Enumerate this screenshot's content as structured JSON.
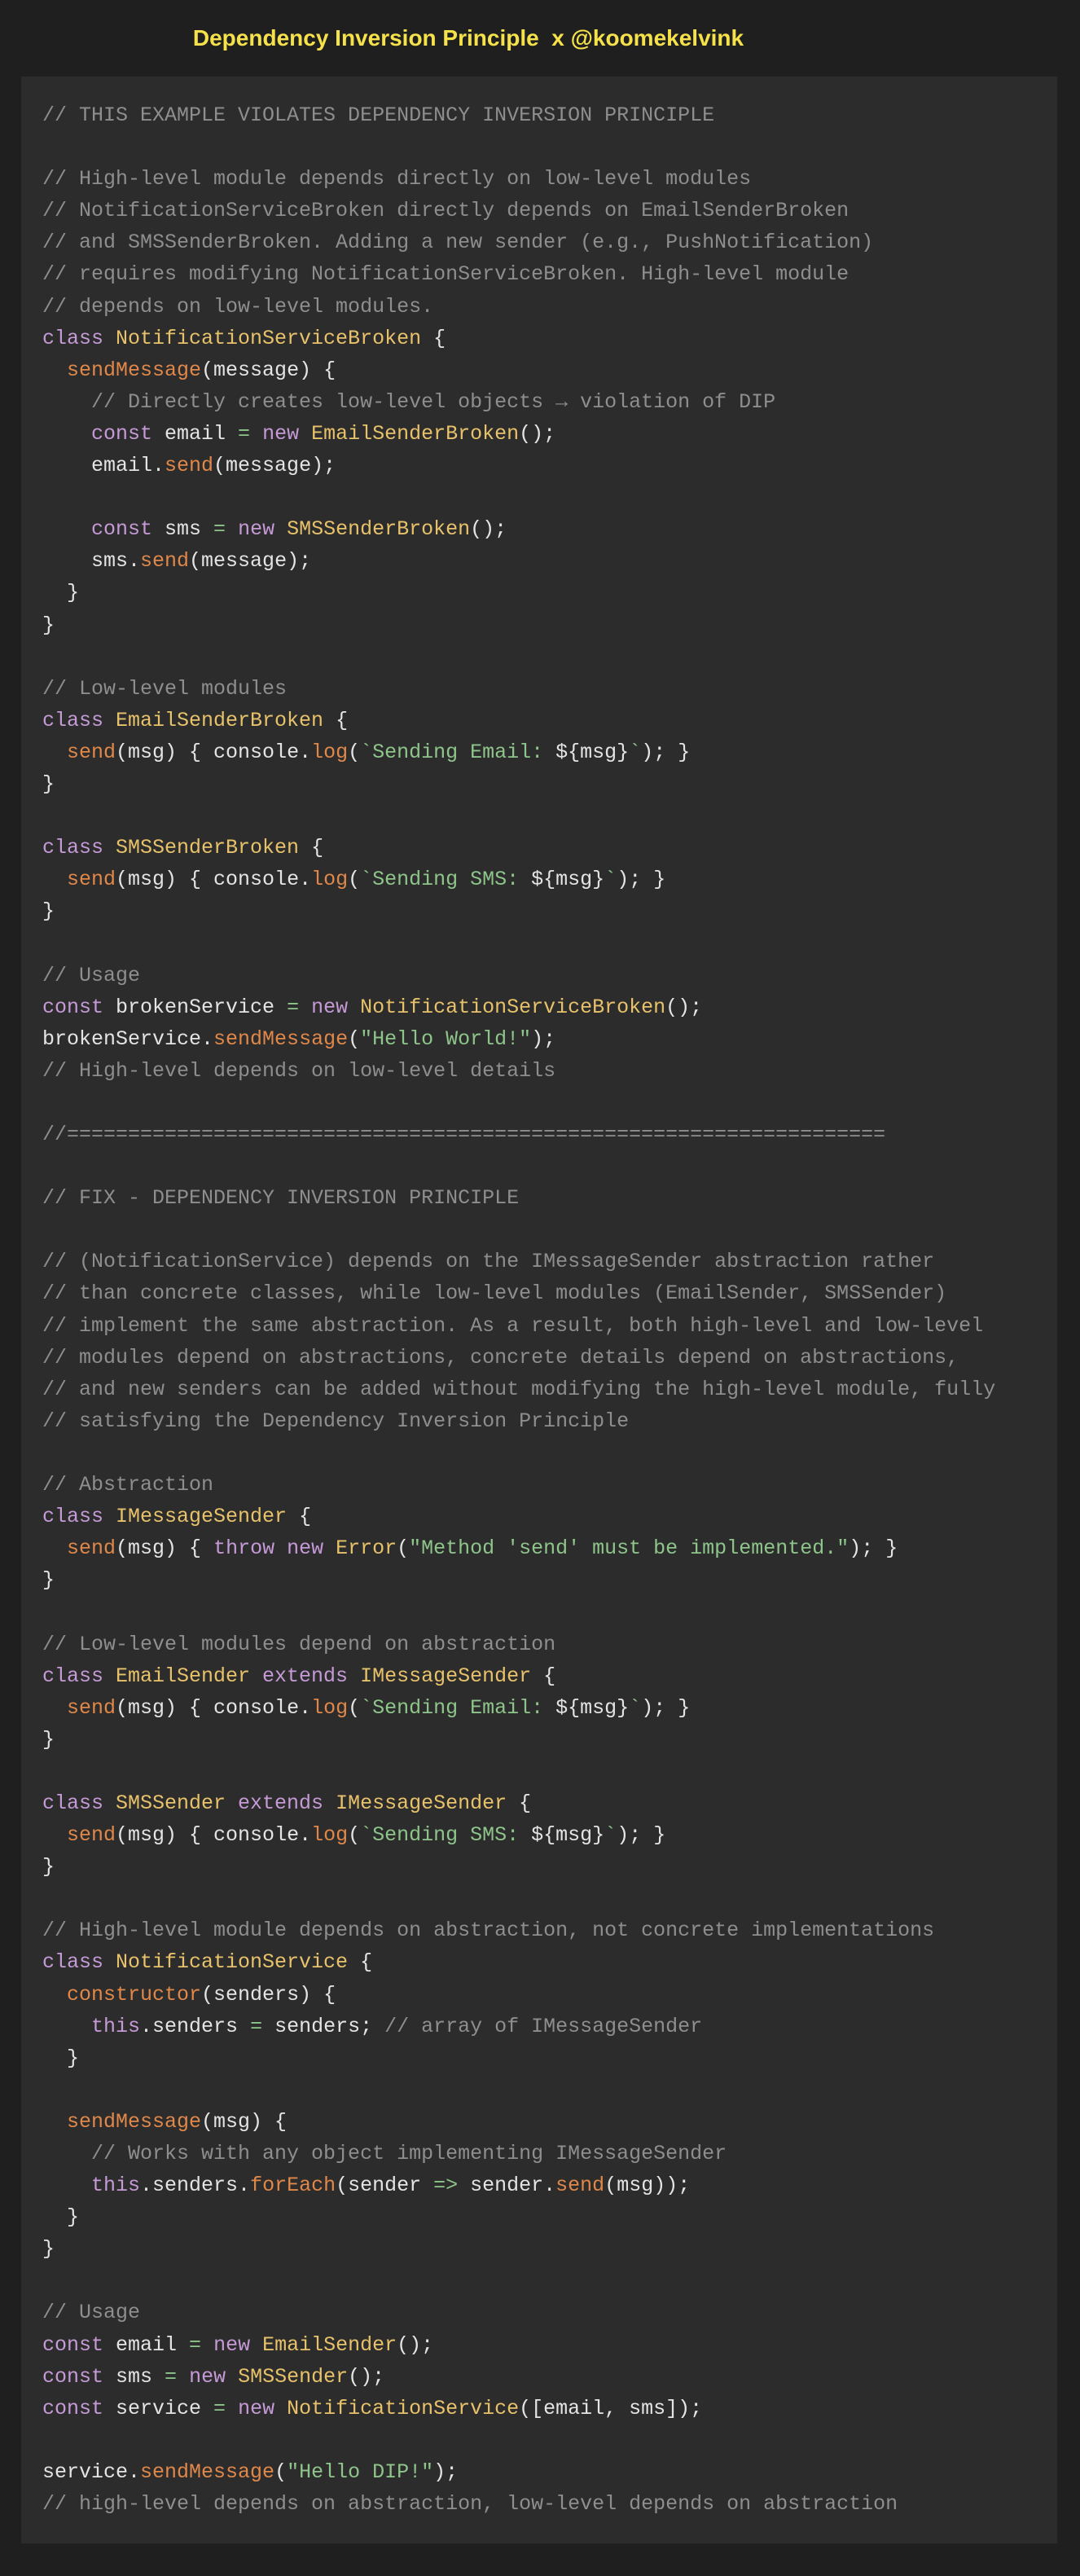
{
  "header": {
    "title": "Dependency Inversion Principle  x @koomekelvink"
  },
  "colors": {
    "background": "#1f1f1f",
    "panel": "#2c2c2c",
    "title": "#f5e14a",
    "comment": "#8e8e8e",
    "keyword": "#c59ad6",
    "class_name": "#e8c26a",
    "function": "#e0884a",
    "string": "#8ec58a",
    "plain": "#e4e4e4"
  },
  "code": {
    "language": "javascript",
    "lines": [
      [
        [
          "comment",
          "// THIS EXAMPLE VIOLATES DEPENDENCY INVERSION PRINCIPLE"
        ]
      ],
      [],
      [
        [
          "comment",
          "// High-level module depends directly on low-level modules"
        ]
      ],
      [
        [
          "comment",
          "// NotificationServiceBroken directly depends on EmailSenderBroken"
        ]
      ],
      [
        [
          "comment",
          "// and SMSSenderBroken. Adding a new sender (e.g., PushNotification)"
        ]
      ],
      [
        [
          "comment",
          "// requires modifying NotificationServiceBroken. High-level module"
        ]
      ],
      [
        [
          "comment",
          "// depends on low-level modules."
        ]
      ],
      [
        [
          "kw",
          "class "
        ],
        [
          "cls",
          "NotificationServiceBroken"
        ],
        [
          "plain",
          " {"
        ]
      ],
      [
        [
          "plain",
          "  "
        ],
        [
          "fn",
          "sendMessage"
        ],
        [
          "plain",
          "(message) {"
        ]
      ],
      [
        [
          "comment",
          "    // Directly creates low-level objects → violation of DIP"
        ]
      ],
      [
        [
          "plain",
          "    "
        ],
        [
          "kw",
          "const "
        ],
        [
          "plain",
          "email "
        ],
        [
          "op",
          "="
        ],
        [
          "plain",
          " "
        ],
        [
          "kw",
          "new "
        ],
        [
          "cls",
          "EmailSenderBroken"
        ],
        [
          "plain",
          "();"
        ]
      ],
      [
        [
          "plain",
          "    email."
        ],
        [
          "fn",
          "send"
        ],
        [
          "plain",
          "(message);"
        ]
      ],
      [],
      [
        [
          "plain",
          "    "
        ],
        [
          "kw",
          "const "
        ],
        [
          "plain",
          "sms "
        ],
        [
          "op",
          "="
        ],
        [
          "plain",
          " "
        ],
        [
          "kw",
          "new "
        ],
        [
          "cls",
          "SMSSenderBroken"
        ],
        [
          "plain",
          "();"
        ]
      ],
      [
        [
          "plain",
          "    sms."
        ],
        [
          "fn",
          "send"
        ],
        [
          "plain",
          "(message);"
        ]
      ],
      [
        [
          "plain",
          "  }"
        ]
      ],
      [
        [
          "plain",
          "}"
        ]
      ],
      [],
      [
        [
          "comment",
          "// Low-level modules"
        ]
      ],
      [
        [
          "kw",
          "class "
        ],
        [
          "cls",
          "EmailSenderBroken"
        ],
        [
          "plain",
          " {"
        ]
      ],
      [
        [
          "plain",
          "  "
        ],
        [
          "fn",
          "send"
        ],
        [
          "plain",
          "(msg) { console."
        ],
        [
          "fn",
          "log"
        ],
        [
          "plain",
          "("
        ],
        [
          "str",
          "`Sending Email: "
        ],
        [
          "plain",
          "${msg}"
        ],
        [
          "str",
          "`"
        ],
        [
          "plain",
          "); }"
        ]
      ],
      [
        [
          "plain",
          "}"
        ]
      ],
      [],
      [
        [
          "kw",
          "class "
        ],
        [
          "cls",
          "SMSSenderBroken"
        ],
        [
          "plain",
          " {"
        ]
      ],
      [
        [
          "plain",
          "  "
        ],
        [
          "fn",
          "send"
        ],
        [
          "plain",
          "(msg) { console."
        ],
        [
          "fn",
          "log"
        ],
        [
          "plain",
          "("
        ],
        [
          "str",
          "`Sending SMS: "
        ],
        [
          "plain",
          "${msg}"
        ],
        [
          "str",
          "`"
        ],
        [
          "plain",
          "); }"
        ]
      ],
      [
        [
          "plain",
          "}"
        ]
      ],
      [],
      [
        [
          "comment",
          "// Usage"
        ]
      ],
      [
        [
          "kw",
          "const "
        ],
        [
          "plain",
          "brokenService "
        ],
        [
          "op",
          "="
        ],
        [
          "plain",
          " "
        ],
        [
          "kw",
          "new "
        ],
        [
          "cls",
          "NotificationServiceBroken"
        ],
        [
          "plain",
          "();"
        ]
      ],
      [
        [
          "plain",
          "brokenService."
        ],
        [
          "fn",
          "sendMessage"
        ],
        [
          "plain",
          "("
        ],
        [
          "str",
          "\"Hello World!\""
        ],
        [
          "plain",
          ");"
        ]
      ],
      [
        [
          "comment",
          "// High-level depends on low-level details"
        ]
      ],
      [],
      [
        [
          "comment",
          "//==================================================================="
        ]
      ],
      [],
      [
        [
          "comment",
          "// FIX - DEPENDENCY INVERSION PRINCIPLE"
        ]
      ],
      [],
      [
        [
          "comment",
          "// (NotificationService) depends on the IMessageSender abstraction rather"
        ]
      ],
      [
        [
          "comment",
          "// than concrete classes, while low-level modules (EmailSender, SMSSender)"
        ]
      ],
      [
        [
          "comment",
          "// implement the same abstraction. As a result, both high-level and low-level"
        ]
      ],
      [
        [
          "comment",
          "// modules depend on abstractions, concrete details depend on abstractions,"
        ]
      ],
      [
        [
          "comment",
          "// and new senders can be added without modifying the high-level module, fully"
        ]
      ],
      [
        [
          "comment",
          "// satisfying the Dependency Inversion Principle"
        ]
      ],
      [],
      [
        [
          "comment",
          "// Abstraction"
        ]
      ],
      [
        [
          "kw",
          "class "
        ],
        [
          "cls",
          "IMessageSender"
        ],
        [
          "plain",
          " {"
        ]
      ],
      [
        [
          "plain",
          "  "
        ],
        [
          "fn",
          "send"
        ],
        [
          "plain",
          "(msg) { "
        ],
        [
          "kw",
          "throw new "
        ],
        [
          "cls",
          "Error"
        ],
        [
          "plain",
          "("
        ],
        [
          "str",
          "\"Method 'send' must be implemented.\""
        ],
        [
          "plain",
          "); }"
        ]
      ],
      [
        [
          "plain",
          "}"
        ]
      ],
      [],
      [
        [
          "comment",
          "// Low-level modules depend on abstraction"
        ]
      ],
      [
        [
          "kw",
          "class "
        ],
        [
          "cls",
          "EmailSender "
        ],
        [
          "kw",
          "extends "
        ],
        [
          "cls",
          "IMessageSender"
        ],
        [
          "plain",
          " {"
        ]
      ],
      [
        [
          "plain",
          "  "
        ],
        [
          "fn",
          "send"
        ],
        [
          "plain",
          "(msg) { console."
        ],
        [
          "fn",
          "log"
        ],
        [
          "plain",
          "("
        ],
        [
          "str",
          "`Sending Email: "
        ],
        [
          "plain",
          "${msg}"
        ],
        [
          "str",
          "`"
        ],
        [
          "plain",
          "); }"
        ]
      ],
      [
        [
          "plain",
          "}"
        ]
      ],
      [],
      [
        [
          "kw",
          "class "
        ],
        [
          "cls",
          "SMSSender "
        ],
        [
          "kw",
          "extends "
        ],
        [
          "cls",
          "IMessageSender"
        ],
        [
          "plain",
          " {"
        ]
      ],
      [
        [
          "plain",
          "  "
        ],
        [
          "fn",
          "send"
        ],
        [
          "plain",
          "(msg) { console."
        ],
        [
          "fn",
          "log"
        ],
        [
          "plain",
          "("
        ],
        [
          "str",
          "`Sending SMS: "
        ],
        [
          "plain",
          "${msg}"
        ],
        [
          "str",
          "`"
        ],
        [
          "plain",
          "); }"
        ]
      ],
      [
        [
          "plain",
          "}"
        ]
      ],
      [],
      [
        [
          "comment",
          "// High-level module depends on abstraction, not concrete implementations"
        ]
      ],
      [
        [
          "kw",
          "class "
        ],
        [
          "cls",
          "NotificationService"
        ],
        [
          "plain",
          " {"
        ]
      ],
      [
        [
          "plain",
          "  "
        ],
        [
          "fn",
          "constructor"
        ],
        [
          "plain",
          "(senders) {"
        ]
      ],
      [
        [
          "plain",
          "    "
        ],
        [
          "kw",
          "this"
        ],
        [
          "plain",
          ".senders "
        ],
        [
          "op",
          "="
        ],
        [
          "plain",
          " senders; "
        ],
        [
          "comment",
          "// array of IMessageSender"
        ]
      ],
      [
        [
          "plain",
          "  }"
        ]
      ],
      [],
      [
        [
          "plain",
          "  "
        ],
        [
          "fn",
          "sendMessage"
        ],
        [
          "plain",
          "(msg) {"
        ]
      ],
      [
        [
          "comment",
          "    // Works with any object implementing IMessageSender"
        ]
      ],
      [
        [
          "plain",
          "    "
        ],
        [
          "kw",
          "this"
        ],
        [
          "plain",
          ".senders."
        ],
        [
          "fn",
          "forEach"
        ],
        [
          "plain",
          "(sender "
        ],
        [
          "op",
          "=>"
        ],
        [
          "plain",
          " sender."
        ],
        [
          "fn",
          "send"
        ],
        [
          "plain",
          "(msg));"
        ]
      ],
      [
        [
          "plain",
          "  }"
        ]
      ],
      [
        [
          "plain",
          "}"
        ]
      ],
      [],
      [
        [
          "comment",
          "// Usage"
        ]
      ],
      [
        [
          "kw",
          "const "
        ],
        [
          "plain",
          "email "
        ],
        [
          "op",
          "="
        ],
        [
          "plain",
          " "
        ],
        [
          "kw",
          "new "
        ],
        [
          "cls",
          "EmailSender"
        ],
        [
          "plain",
          "();"
        ]
      ],
      [
        [
          "kw",
          "const "
        ],
        [
          "plain",
          "sms "
        ],
        [
          "op",
          "="
        ],
        [
          "plain",
          " "
        ],
        [
          "kw",
          "new "
        ],
        [
          "cls",
          "SMSSender"
        ],
        [
          "plain",
          "();"
        ]
      ],
      [
        [
          "kw",
          "const "
        ],
        [
          "plain",
          "service "
        ],
        [
          "op",
          "="
        ],
        [
          "plain",
          " "
        ],
        [
          "kw",
          "new "
        ],
        [
          "cls",
          "NotificationService"
        ],
        [
          "plain",
          "([email, sms]);"
        ]
      ],
      [],
      [
        [
          "plain",
          "service."
        ],
        [
          "fn",
          "sendMessage"
        ],
        [
          "plain",
          "("
        ],
        [
          "str",
          "\"Hello DIP!\""
        ],
        [
          "plain",
          ");"
        ]
      ],
      [
        [
          "comment",
          "// high-level depends on abstraction, low-level depends on abstraction"
        ]
      ]
    ]
  }
}
